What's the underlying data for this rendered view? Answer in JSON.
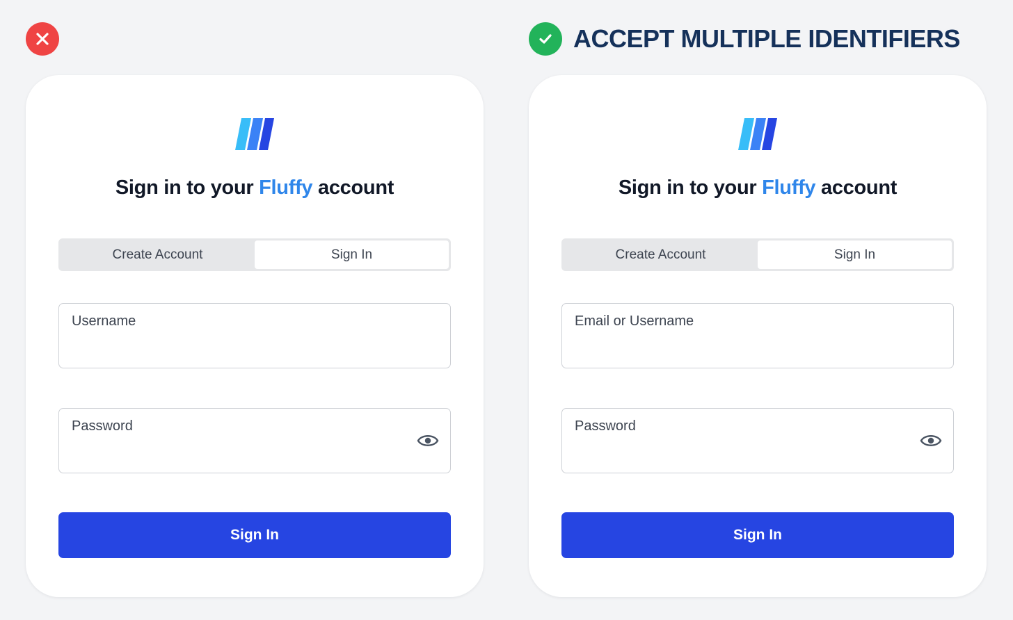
{
  "heading_good": "ACCEPT MULTIPLE IDENTIFIERS",
  "colors": {
    "bad": "#ef4444",
    "good": "#22b35a",
    "brand": "#2f86ea",
    "button": "#2645e2",
    "heading": "#15315a"
  },
  "icons": {
    "bad_badge": "close-icon",
    "good_badge": "check-icon",
    "password_toggle": "eye-icon",
    "logo": "three-slash-logo"
  },
  "left_card": {
    "title_prefix": "Sign in to your ",
    "title_brand": "Fluffy",
    "title_suffix": " account",
    "tabs": [
      {
        "label": "Create Account",
        "active": false
      },
      {
        "label": "Sign In",
        "active": true
      }
    ],
    "username_label": "Username",
    "password_label": "Password",
    "button_label": "Sign In"
  },
  "right_card": {
    "title_prefix": "Sign in to your ",
    "title_brand": "Fluffy",
    "title_suffix": " account",
    "tabs": [
      {
        "label": "Create Account",
        "active": false
      },
      {
        "label": "Sign In",
        "active": true
      }
    ],
    "username_label": "Email or Username",
    "password_label": "Password",
    "button_label": "Sign In"
  }
}
